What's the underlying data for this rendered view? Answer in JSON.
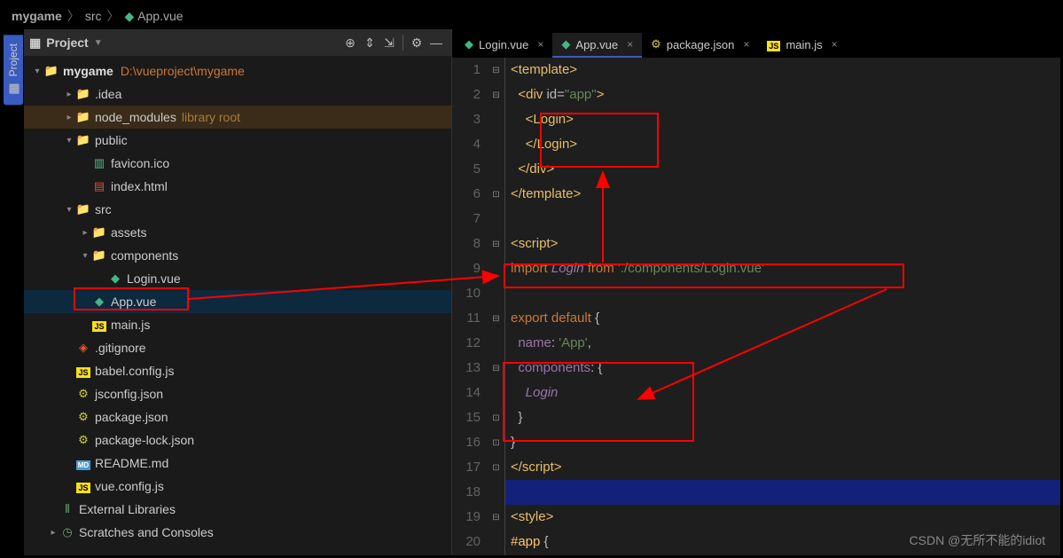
{
  "breadcrumb": [
    "mygame",
    "src",
    "App.vue"
  ],
  "sidebar": {
    "title": "Project",
    "toolbar_icons": [
      "target",
      "collapse",
      "expand",
      "gear",
      "hide"
    ],
    "root": {
      "name": "mygame",
      "path": "D:\\vueproject\\mygame"
    },
    "nodes": [
      {
        "name": ".idea",
        "icon": "folder",
        "depth": 2,
        "arr": ">"
      },
      {
        "name": "node_modules",
        "icon": "folder",
        "depth": 2,
        "arr": ">",
        "suffix": "library root",
        "lib": true
      },
      {
        "name": "public",
        "icon": "folder",
        "depth": 2,
        "arr": "v"
      },
      {
        "name": "favicon.ico",
        "icon": "ico",
        "depth": 3
      },
      {
        "name": "index.html",
        "icon": "html",
        "depth": 3
      },
      {
        "name": "src",
        "icon": "folder",
        "depth": 2,
        "arr": "v"
      },
      {
        "name": "assets",
        "icon": "folder",
        "depth": 3,
        "arr": ">"
      },
      {
        "name": "components",
        "icon": "folder",
        "depth": 3,
        "arr": "v"
      },
      {
        "name": "Login.vue",
        "icon": "vue",
        "depth": 4
      },
      {
        "name": "App.vue",
        "icon": "vue",
        "depth": 3,
        "sel": true
      },
      {
        "name": "main.js",
        "icon": "js",
        "depth": 3
      },
      {
        "name": ".gitignore",
        "icon": "git",
        "depth": 2
      },
      {
        "name": "babel.config.js",
        "icon": "js",
        "depth": 2
      },
      {
        "name": "jsconfig.json",
        "icon": "json",
        "depth": 2
      },
      {
        "name": "package.json",
        "icon": "json",
        "depth": 2
      },
      {
        "name": "package-lock.json",
        "icon": "json",
        "depth": 2
      },
      {
        "name": "README.md",
        "icon": "md",
        "depth": 2
      },
      {
        "name": "vue.config.js",
        "icon": "js",
        "depth": 2
      }
    ],
    "extra": [
      "External Libraries",
      "Scratches and Consoles"
    ]
  },
  "tabs": [
    {
      "label": "Login.vue",
      "icon": "vue"
    },
    {
      "label": "App.vue",
      "icon": "vue",
      "active": true
    },
    {
      "label": "package.json",
      "icon": "json"
    },
    {
      "label": "main.js",
      "icon": "js"
    }
  ],
  "code": [
    {
      "n": 1,
      "html": "<span class='c-tag'>&lt;template&gt;</span>"
    },
    {
      "n": 2,
      "html": "  <span class='c-tag'>&lt;div</span> <span class='c-attr'>id</span>=<span class='c-str'>\"app\"</span><span class='c-tag'>&gt;</span>"
    },
    {
      "n": 3,
      "html": "    <span class='c-tag'>&lt;Login&gt;</span>"
    },
    {
      "n": 4,
      "html": "    <span class='c-tag'>&lt;/Login&gt;</span>"
    },
    {
      "n": 5,
      "html": "  <span class='c-tag'>&lt;/div&gt;</span>"
    },
    {
      "n": 6,
      "html": "<span class='c-tag'>&lt;/template&gt;</span>"
    },
    {
      "n": 7,
      "html": ""
    },
    {
      "n": 8,
      "html": "<span class='c-tag'>&lt;script&gt;</span>"
    },
    {
      "n": 9,
      "html": "<span class='c-key'>import</span> <span class='c-id'>Login</span> <span class='c-key'>from</span> <span class='c-str'>'./components/Login.vue'</span>"
    },
    {
      "n": 10,
      "html": ""
    },
    {
      "n": 11,
      "html": "<span class='c-key'>export default </span>{"
    },
    {
      "n": 12,
      "html": "  <span class='c-prop'>name</span>: <span class='c-str'>'App'</span>,"
    },
    {
      "n": 13,
      "html": "  <span class='c-prop'>components</span>: {"
    },
    {
      "n": 14,
      "html": "    <span class='c-id'>Login</span>"
    },
    {
      "n": 15,
      "html": "  }"
    },
    {
      "n": 16,
      "html": "}"
    },
    {
      "n": 17,
      "html": "<span class='c-tag'>&lt;/script&gt;</span>"
    },
    {
      "n": 18,
      "html": "",
      "hl": true
    },
    {
      "n": 19,
      "html": "<span class='c-tag'>&lt;style&gt;</span>"
    },
    {
      "n": 20,
      "html": "<span class='c-fn'>#app</span> {"
    }
  ],
  "watermark": "CSDN @无所不能的idiot"
}
